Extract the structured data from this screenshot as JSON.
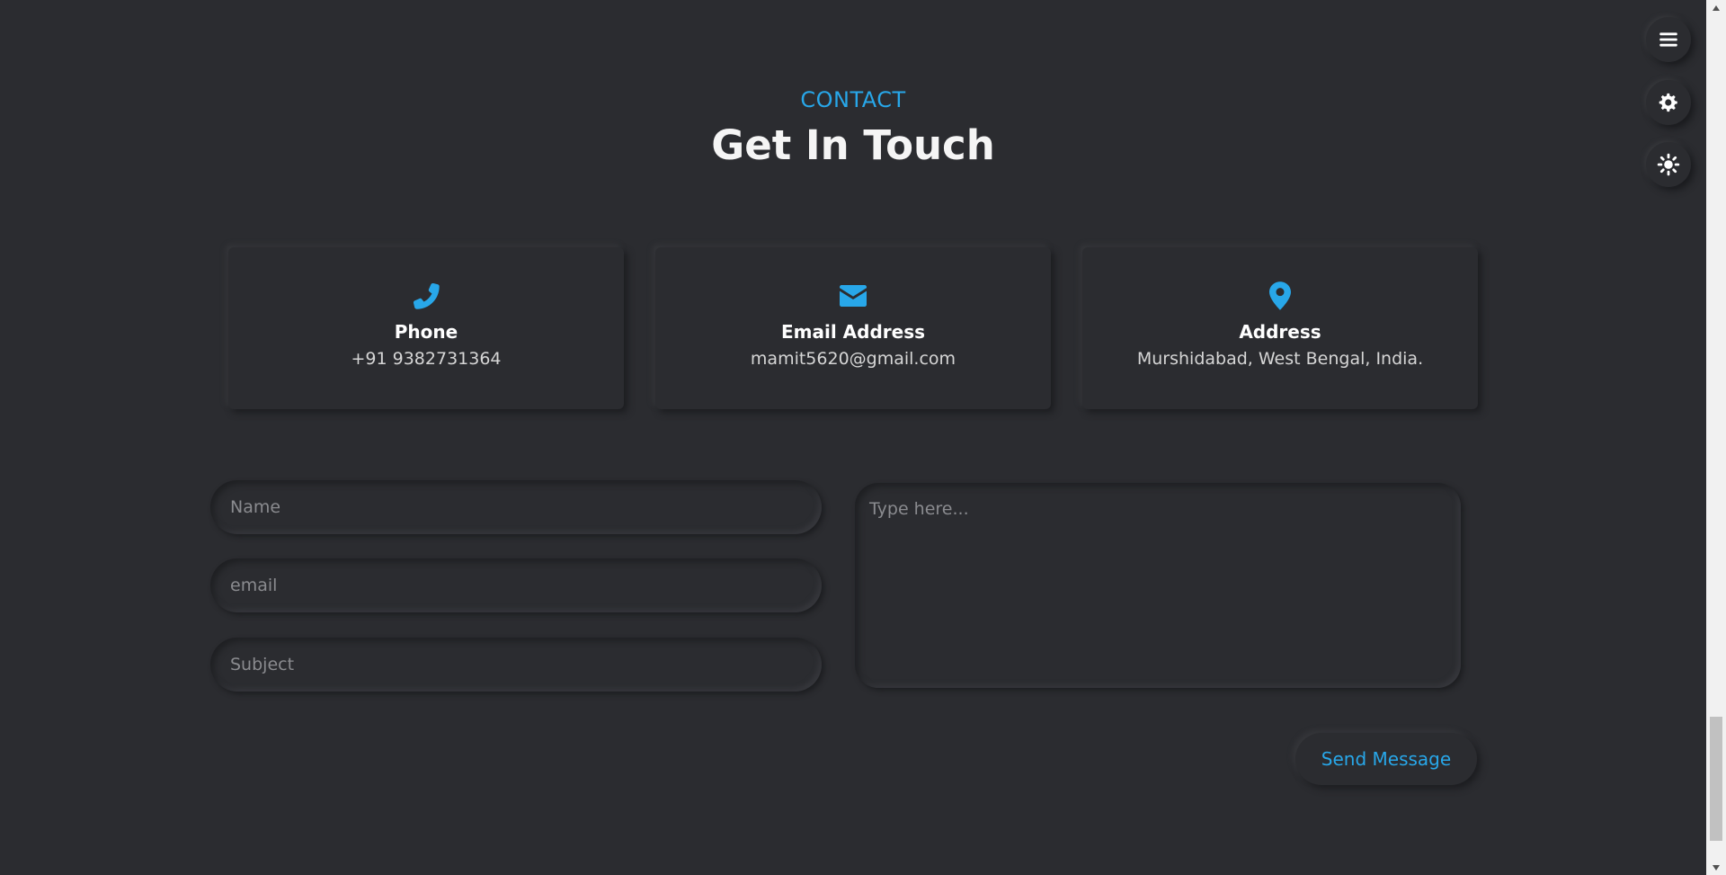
{
  "header": {
    "eyebrow": "CONTACT",
    "title": "Get In Touch"
  },
  "cards": [
    {
      "icon": "phone-icon",
      "heading": "Phone",
      "value": "+91 9382731364"
    },
    {
      "icon": "envelope-icon",
      "heading": "Email Address",
      "value": "mamit5620@gmail.com"
    },
    {
      "icon": "map-pin-icon",
      "heading": "Address",
      "value": "Murshidabad, West Bengal, India."
    }
  ],
  "form": {
    "name_placeholder": "Name",
    "email_placeholder": "email",
    "subject_placeholder": "Subject",
    "message_placeholder": "Type here...",
    "send_label": "Send Message"
  },
  "floating_buttons": [
    {
      "icon": "hamburger-menu-icon"
    },
    {
      "icon": "gear-icon"
    },
    {
      "icon": "sun-icon"
    }
  ],
  "colors": {
    "accent": "#28a7e9",
    "background": "#2b2c30",
    "text": "#ffffff",
    "muted_text": "#d6d6d6"
  }
}
